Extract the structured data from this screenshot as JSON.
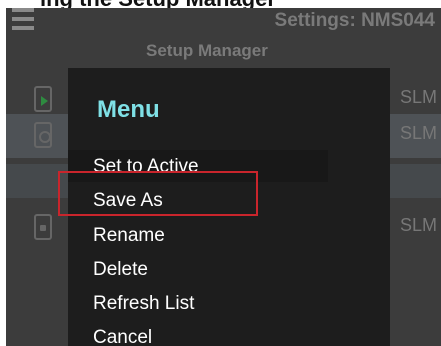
{
  "caption": "ing     the    Setup    Manager",
  "header": {
    "settings_title": "Settings: NMS044",
    "setup_title": "Setup Manager"
  },
  "rows": [
    {
      "label": "SLM",
      "icon": "play-document-icon"
    },
    {
      "label": "SLM",
      "icon": "gear-document-icon"
    },
    {
      "label": "SLM",
      "icon": "lock-document-icon"
    }
  ],
  "menu": {
    "title": "Menu",
    "items": [
      "Set to Active",
      "Save As",
      "Rename",
      "Delete",
      "Refresh List",
      "Cancel"
    ],
    "highlighted_item": "Save As"
  },
  "colors": {
    "app_background": "#3c3c3c",
    "menu_background": "#1d1d1d",
    "menu_title": "#7fe0e6",
    "highlight_border": "#c9252c"
  }
}
